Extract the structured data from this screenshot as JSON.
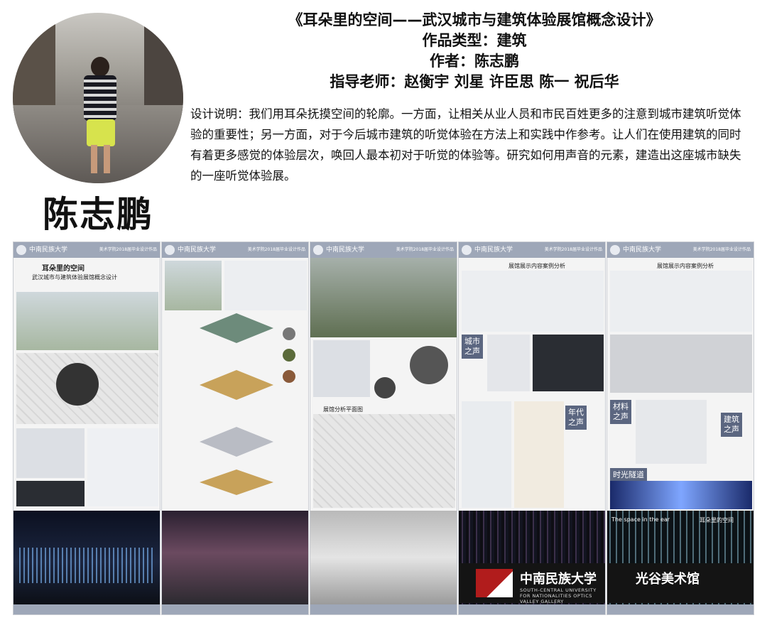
{
  "header": {
    "project_title": "《耳朵里的空间——武汉城市与建筑体验展馆概念设计》",
    "category": "作品类型：建筑",
    "author_line": "作者：陈志鹏",
    "advisors": "指导老师：赵衡宇 刘星 许臣思 陈一 祝后华",
    "author_name": "陈志鹏"
  },
  "description": "设计说明：我们用耳朵抚摸空间的轮廓。一方面，让相关从业人员和市民百姓更多的注意到城市建筑听觉体验的重要性；另一方面，对于今后城市建筑的听觉体验在方法上和实践中作参考。让人们在使用建筑的同时有着更多感觉的体验层次，唤回人最本初对于听觉的体验等。研究如何用声音的元素，建造出这座城市缺失的一座听觉体验展。",
  "boards": {
    "university": "中南民族大学",
    "year_label": "美术学院2018届毕业设计作品",
    "board1_title": "耳朵里的空间",
    "board1_subtitle": "武汉城市与建筑体验展馆概念设计",
    "board3_plan": "展馆分析平面图",
    "board4_table_title": "展馆展示内容案例分析",
    "board5_table_title": "展馆展示内容案例分析",
    "tag_city": "城市\n之声",
    "tag_material": "材料\n之声",
    "tag_era": "年代\n之声",
    "tag_building": "建筑\n之声",
    "tag_tunnel": "时光隧道",
    "space_caption": "The space in the ear",
    "space_caption_cn": "耳朵里的空间",
    "banner_cn": "中南民族大学",
    "banner_gallery": "光谷美术馆",
    "banner_en": "SOUTH-CENTRAL UNIVERSITY FOR NATIONALITIES OPTICS VALLEY GALLERY"
  }
}
